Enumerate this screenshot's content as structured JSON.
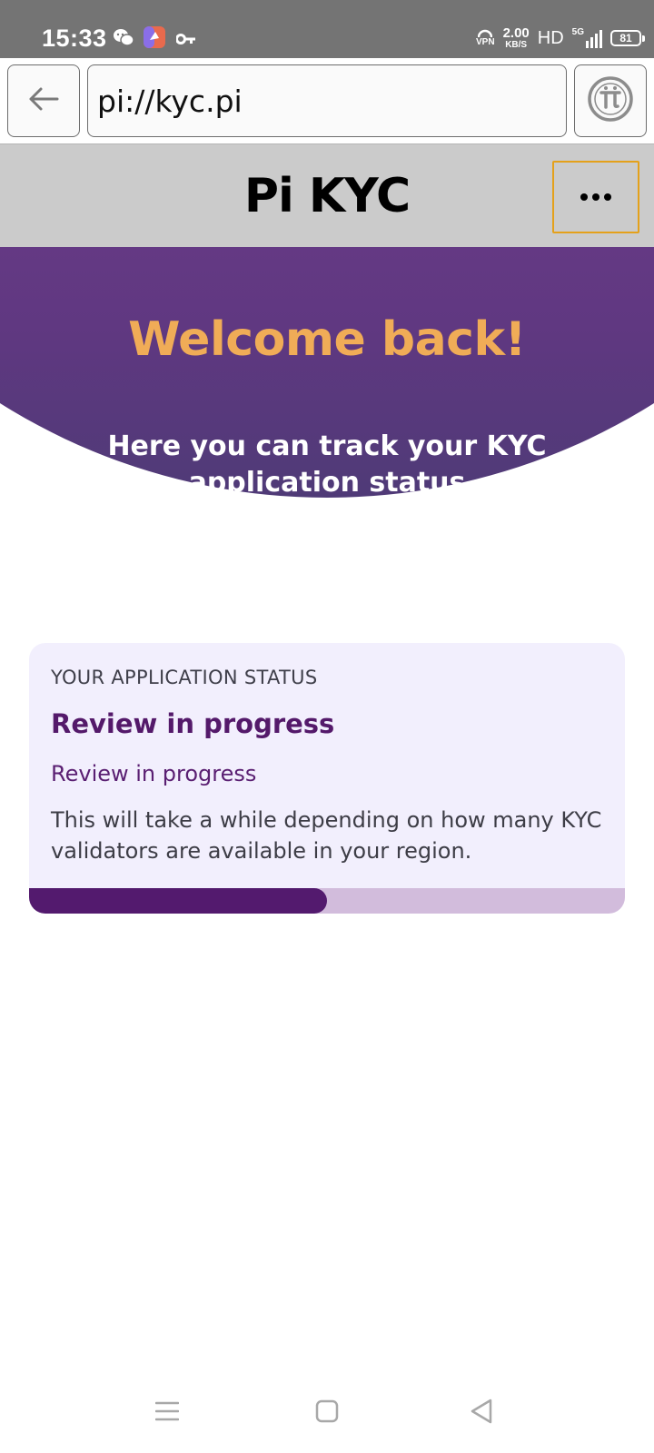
{
  "status_bar": {
    "time": "15:33",
    "left_icons": [
      "wechat-icon",
      "app-icon",
      "key-icon"
    ],
    "vpn_label": "VPN",
    "net_speed_value": "2.00",
    "net_speed_unit": "KB/S",
    "hd_label": "HD",
    "network_label": "5G",
    "battery_level": "81"
  },
  "browser": {
    "back_icon": "arrow-left-icon",
    "url": "pi://kyc.pi",
    "pi_icon": "pi-logo-icon"
  },
  "app_header": {
    "title": "Pi KYC",
    "menu_icon": "more-dots-icon"
  },
  "hero": {
    "title": "Welcome back!",
    "subtitle": "Here you can track your KYC application status"
  },
  "status_card": {
    "label": "YOUR APPLICATION STATUS",
    "title": "Review in progress",
    "status_text": "Review in progress",
    "description": "This will take a while depending on how many KYC validators are available in your region.",
    "progress_percent": 50
  },
  "nav_bar": {
    "items": [
      "menu-icon",
      "home-square-icon",
      "back-triangle-icon"
    ]
  },
  "colors": {
    "hero_purple": "#5b3182",
    "hero_title": "#f0ac57",
    "card_bg": "#f2effd",
    "progress_fill": "#531a6e",
    "progress_track": "#d2bcdc",
    "menu_border": "#e4a11b"
  }
}
